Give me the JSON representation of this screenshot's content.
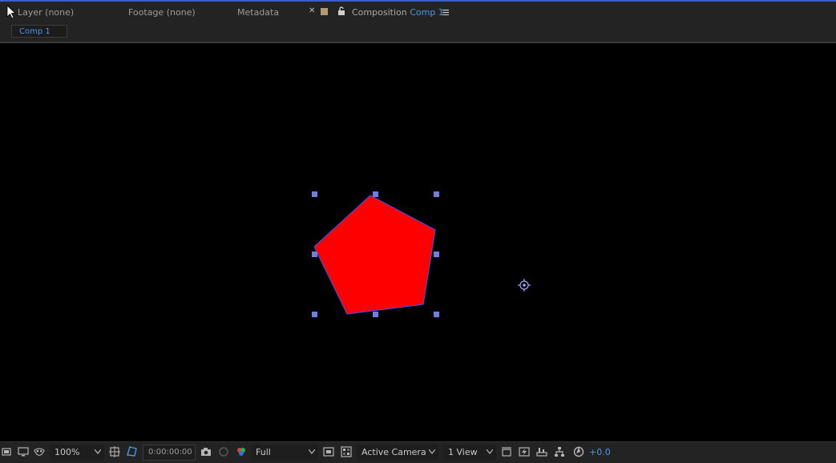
{
  "tabs": {
    "layer": "Layer (none)",
    "footage": "Footage (none)",
    "metadata": "Metadata",
    "composition_prefix": "Composition",
    "composition_name": "Comp 1"
  },
  "breadcrumb": {
    "label": "Comp 1"
  },
  "viewer": {
    "shape": "pentagon",
    "fill_color": "#ff0000",
    "stroke_color": "#4a4adf",
    "handle_color": "#6f7fe0"
  },
  "toolbar": {
    "magnification": "100%",
    "timecode": "0:00:00:00",
    "resolution": "Full",
    "camera": "Active Camera",
    "views": "1 View",
    "exposure": "+0.0"
  },
  "colors": {
    "accent": "#4a97e8",
    "panel_bg": "#232323",
    "viewer_bg": "#000000"
  }
}
